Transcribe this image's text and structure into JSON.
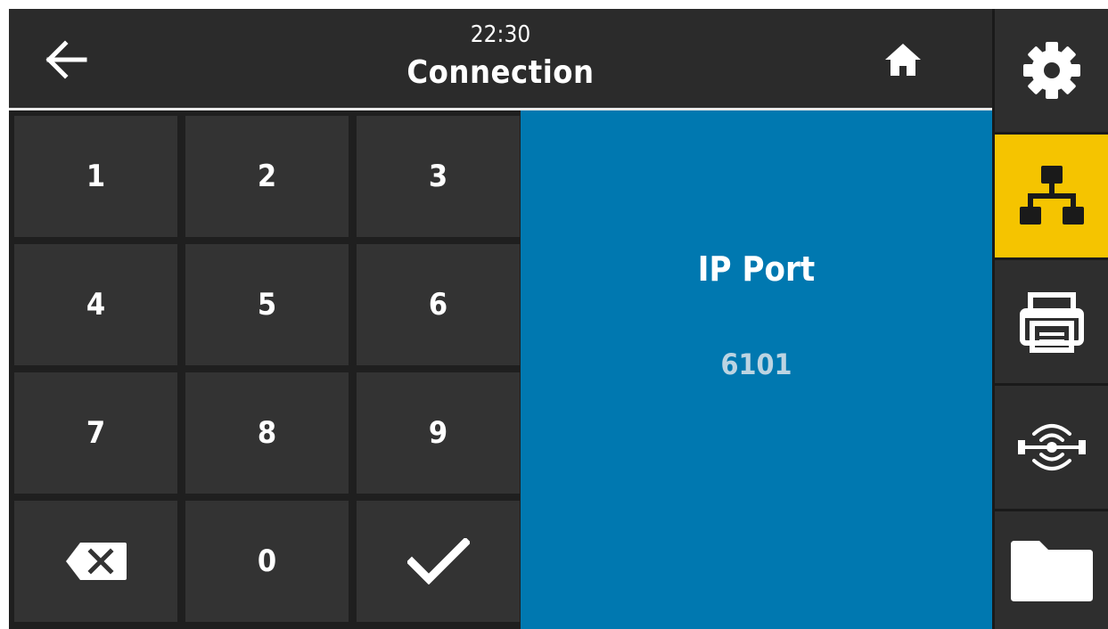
{
  "header": {
    "time": "22:30",
    "title": "Connection",
    "back_icon": "arrow-left-icon",
    "home_icon": "home-icon"
  },
  "keypad": {
    "keys": [
      "1",
      "2",
      "3",
      "4",
      "5",
      "6",
      "7",
      "8",
      "9",
      "0"
    ],
    "backspace_icon": "backspace-icon",
    "confirm_icon": "checkmark-icon"
  },
  "field": {
    "label": "IP Port",
    "value": "6101"
  },
  "sidebar": {
    "items": [
      {
        "name": "settings",
        "icon": "gear-icon",
        "active": false
      },
      {
        "name": "connection",
        "icon": "network-icon",
        "active": true
      },
      {
        "name": "print",
        "icon": "printer-icon",
        "active": false
      },
      {
        "name": "sensors",
        "icon": "sensor-icon",
        "active": false
      },
      {
        "name": "storage",
        "icon": "folder-icon",
        "active": false
      }
    ]
  },
  "colors": {
    "accent_active": "#f5c400",
    "panel_blue": "#0078b0",
    "header_bg": "#2b2b2b",
    "key_bg": "#333333"
  }
}
